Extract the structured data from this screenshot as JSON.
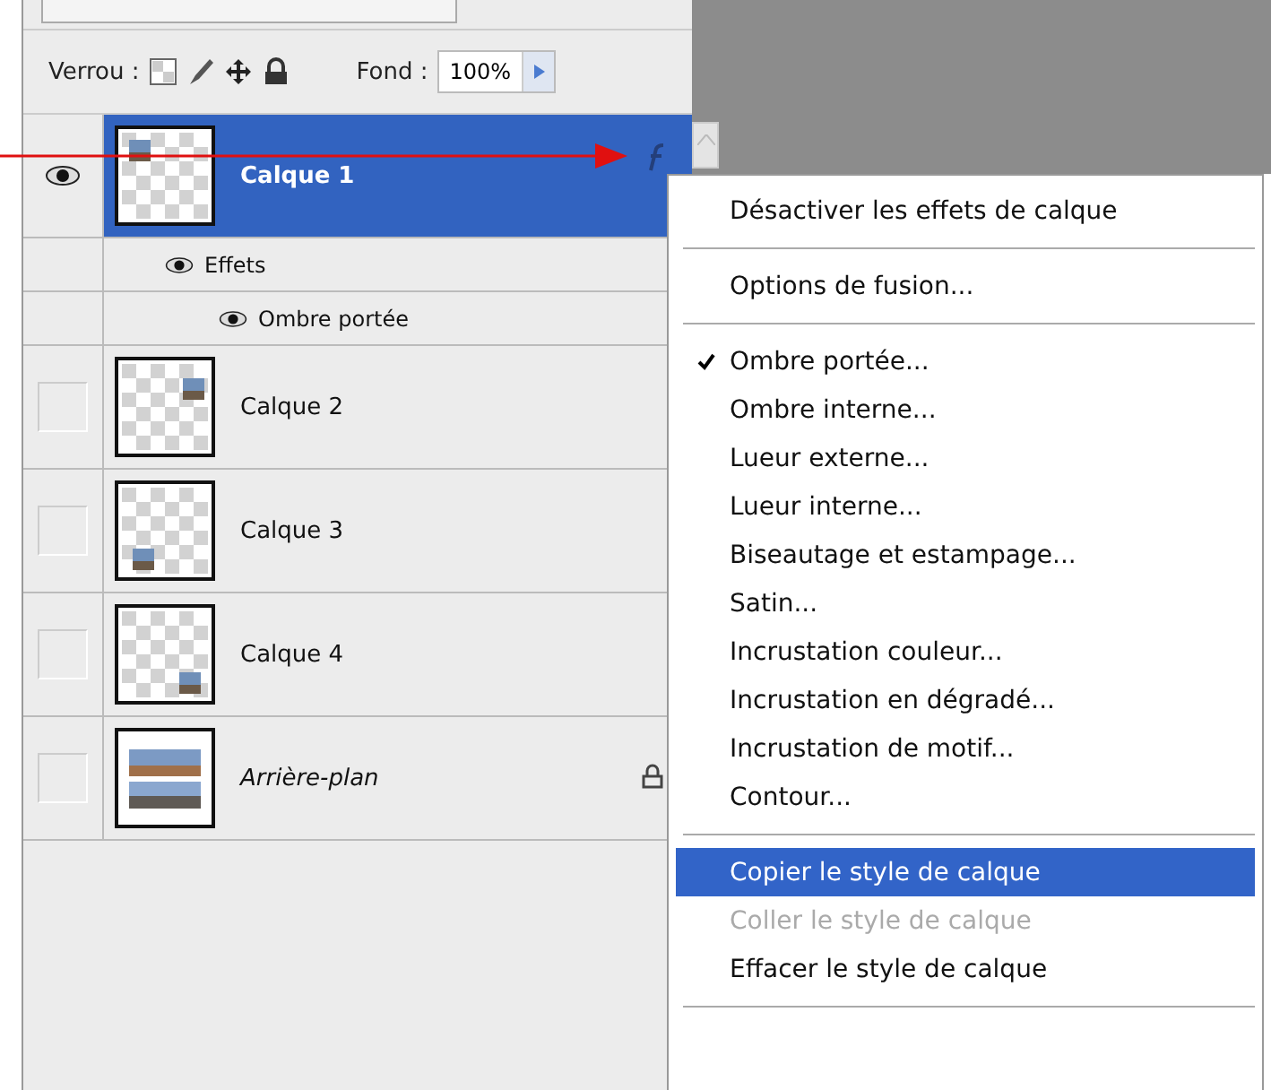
{
  "lock": {
    "label": "Verrou :"
  },
  "fill": {
    "label": "Fond :",
    "value": "100%"
  },
  "layers": [
    {
      "name": "Calque 1",
      "kind": "layer",
      "visible": true,
      "selected": true,
      "effects": {
        "label": "Effets",
        "visible": true,
        "children": [
          {
            "label": "Ombre portée",
            "visible": true
          }
        ]
      }
    },
    {
      "name": "Calque 2",
      "kind": "layer",
      "visible": false,
      "selected": false
    },
    {
      "name": "Calque 3",
      "kind": "layer",
      "visible": false,
      "selected": false
    },
    {
      "name": "Calque 4",
      "kind": "layer",
      "visible": false,
      "selected": false
    },
    {
      "name": "Arrière-plan",
      "kind": "background",
      "visible": false,
      "selected": false
    }
  ],
  "menu": [
    {
      "kind": "item",
      "label": "Désactiver les effets de calque",
      "checked": false,
      "selected": false,
      "disabled": false
    },
    {
      "kind": "separator"
    },
    {
      "kind": "item",
      "label": "Options de fusion...",
      "checked": false,
      "selected": false,
      "disabled": false
    },
    {
      "kind": "separator"
    },
    {
      "kind": "item",
      "label": "Ombre portée...",
      "checked": true,
      "selected": false,
      "disabled": false
    },
    {
      "kind": "item",
      "label": "Ombre interne...",
      "checked": false,
      "selected": false,
      "disabled": false
    },
    {
      "kind": "item",
      "label": "Lueur externe...",
      "checked": false,
      "selected": false,
      "disabled": false
    },
    {
      "kind": "item",
      "label": "Lueur interne...",
      "checked": false,
      "selected": false,
      "disabled": false
    },
    {
      "kind": "item",
      "label": "Biseautage et estampage...",
      "checked": false,
      "selected": false,
      "disabled": false
    },
    {
      "kind": "item",
      "label": "Satin...",
      "checked": false,
      "selected": false,
      "disabled": false
    },
    {
      "kind": "item",
      "label": "Incrustation couleur...",
      "checked": false,
      "selected": false,
      "disabled": false
    },
    {
      "kind": "item",
      "label": "Incrustation en dégradé...",
      "checked": false,
      "selected": false,
      "disabled": false
    },
    {
      "kind": "item",
      "label": "Incrustation de motif...",
      "checked": false,
      "selected": false,
      "disabled": false
    },
    {
      "kind": "item",
      "label": "Contour...",
      "checked": false,
      "selected": false,
      "disabled": false
    },
    {
      "kind": "separator"
    },
    {
      "kind": "item",
      "label": "Copier le style de calque",
      "checked": false,
      "selected": true,
      "disabled": false
    },
    {
      "kind": "item",
      "label": "Coller le style de calque",
      "checked": false,
      "selected": false,
      "disabled": true
    },
    {
      "kind": "item",
      "label": "Effacer le style de calque",
      "checked": false,
      "selected": false,
      "disabled": false
    },
    {
      "kind": "separator"
    }
  ]
}
